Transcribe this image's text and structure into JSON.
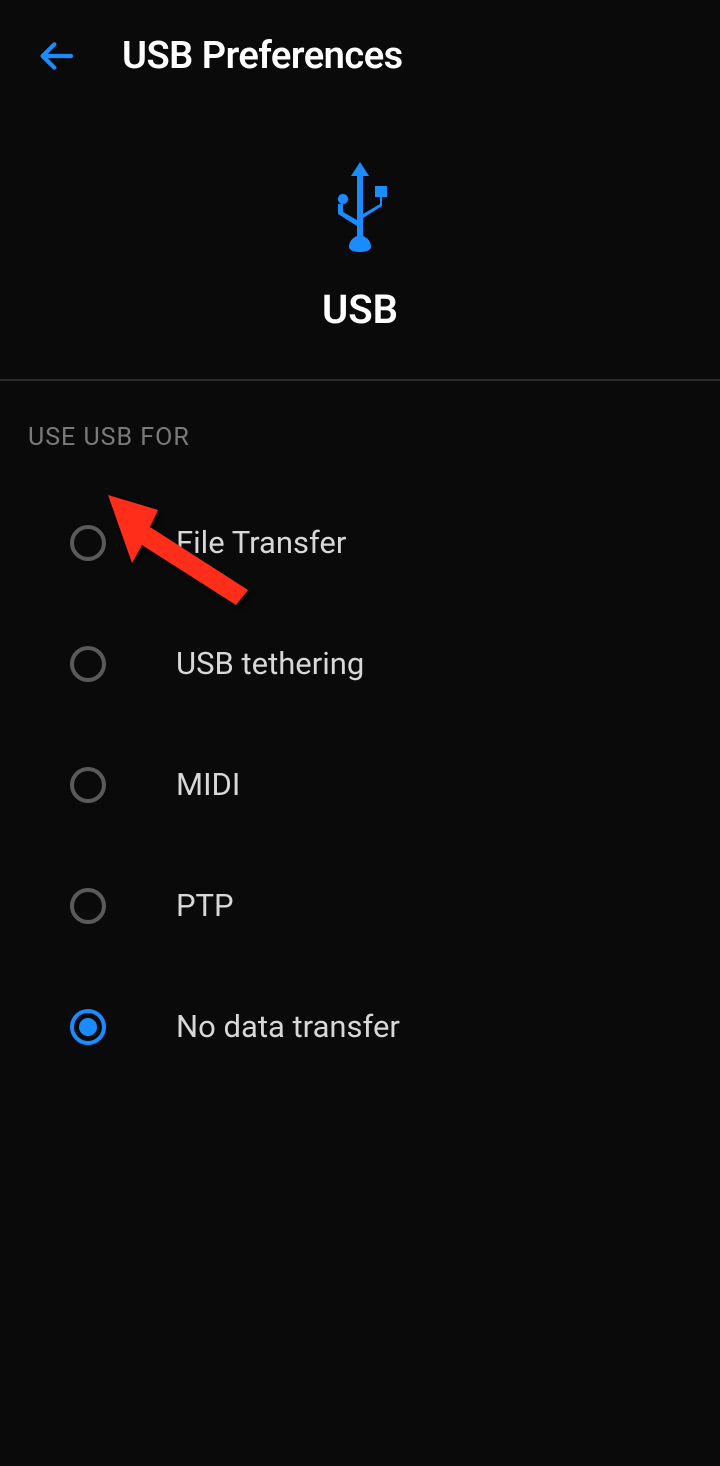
{
  "header": {
    "title": "USB Preferences"
  },
  "hero": {
    "label": "USB"
  },
  "section": {
    "title": "USE USB FOR"
  },
  "options": [
    {
      "label": "File Transfer",
      "selected": false
    },
    {
      "label": "USB tethering",
      "selected": false
    },
    {
      "label": "MIDI",
      "selected": false
    },
    {
      "label": "PTP",
      "selected": false
    },
    {
      "label": "No data transfer",
      "selected": true
    }
  ]
}
